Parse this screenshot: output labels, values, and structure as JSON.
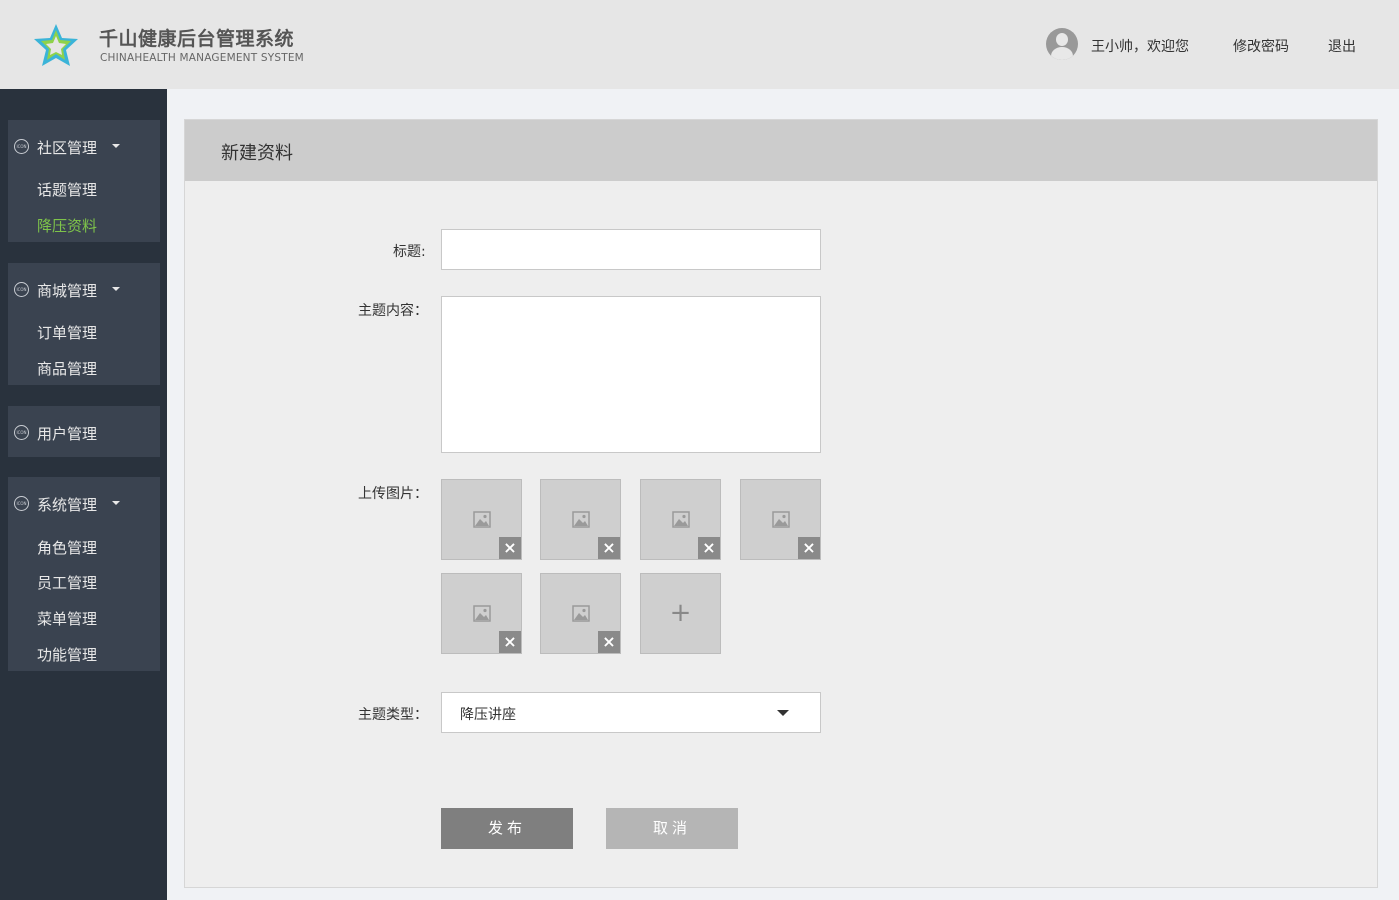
{
  "header": {
    "app_title": "千山健康后台管理系统",
    "app_subtitle": "CHINAHEALTH  MANAGEMENT SYSTEM",
    "welcome_text": "王小帅，欢迎您",
    "change_password": "修改密码",
    "logout": "退出"
  },
  "sidebar": {
    "icon_text": "ICON",
    "groups": [
      {
        "label": "社区管理",
        "items": [
          "话题管理",
          "降压资料"
        ],
        "active_item": "降压资料"
      },
      {
        "label": "商城管理",
        "items": [
          "订单管理",
          "商品管理"
        ]
      },
      {
        "label": "用户管理",
        "items": []
      },
      {
        "label": "系统管理",
        "items": [
          "角色管理",
          "员工管理",
          "菜单管理",
          "功能管理"
        ]
      }
    ]
  },
  "form": {
    "panel_title": "新建资料",
    "title_label": "标题:",
    "title_value": "",
    "content_label": "主题内容：",
    "content_value": "",
    "upload_label": "上传图片：",
    "delete_symbol": "×",
    "add_symbol": "+",
    "type_label": "主题类型：",
    "type_value": "降压讲座",
    "publish_button": "发布",
    "cancel_button": "取消"
  },
  "colors": {
    "header_bg": "#e6e6e6",
    "sidebar_bg": "#29323d",
    "menu_group_bg": "#3a4350",
    "active_item": "#7ec44a",
    "panel_head_bg": "#cccccc",
    "publish_bg": "#7f7f7f",
    "cancel_bg": "#b5b5b5"
  }
}
